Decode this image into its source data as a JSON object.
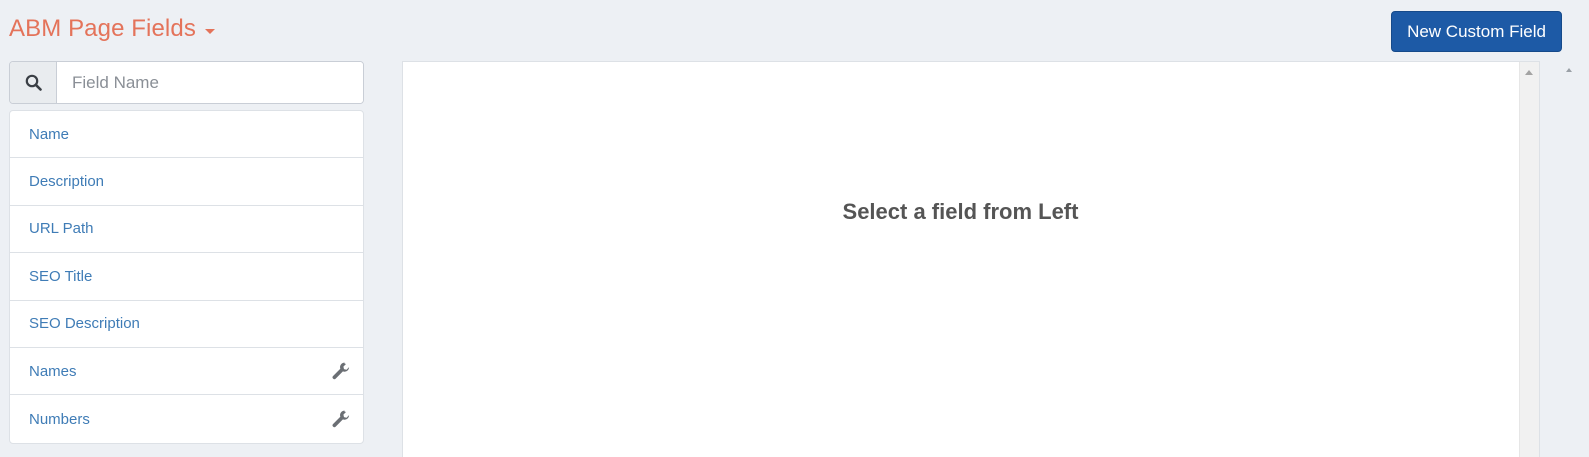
{
  "header": {
    "title": "ABM Page Fields",
    "title_color": "#e4735a",
    "dropdown_icon": "caret-down-icon",
    "new_button_label": "New Custom Field",
    "new_button_color": "#1d5aa6"
  },
  "search": {
    "icon": "search-icon",
    "value": "",
    "placeholder": "Field Name"
  },
  "fields": [
    {
      "label": "Name",
      "custom": false
    },
    {
      "label": "Description",
      "custom": false
    },
    {
      "label": "URL Path",
      "custom": false
    },
    {
      "label": "SEO Title",
      "custom": false
    },
    {
      "label": "SEO Description",
      "custom": false
    },
    {
      "label": "Names",
      "custom": true,
      "icon": "wrench-icon"
    },
    {
      "label": "Numbers",
      "custom": true,
      "icon": "wrench-icon"
    }
  ],
  "main": {
    "empty_message": "Select a field from Left"
  },
  "colors": {
    "link": "#3f7cb6",
    "background": "#edf0f4"
  }
}
